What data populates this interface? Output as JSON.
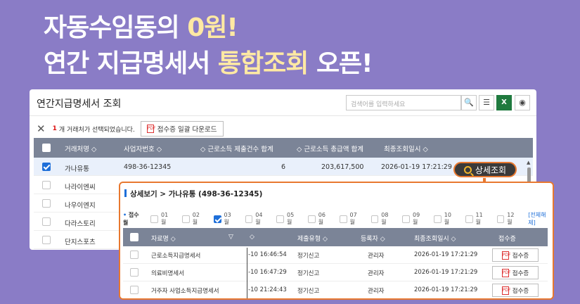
{
  "headline": {
    "line1_a": "자동수임동의 ",
    "line1_b": "0원!",
    "line2_a": "연간 지급명세서 ",
    "line2_b": "통합조회",
    "line2_c": " 오픈!"
  },
  "panel": {
    "title": "연간지급명세서 조회",
    "search_placeholder": "검색어를 입력하세요",
    "selection": {
      "count": "1",
      "text": "개 거래처가 선택되었습니다.",
      "download_label": "접수증 일괄 다운로드"
    },
    "columns": [
      "거래처명 ◇",
      "사업자번호 ◇",
      "◇ 근로소득 제출건수 합계",
      "◇ 근로소득 총급액 합계",
      "최종조회일시 ◇"
    ],
    "rows": [
      {
        "name": "가나유통",
        "bizno": "498-36-12345",
        "count": "6",
        "amount": "203,617,500",
        "date": "2026-01-19 17:21:29"
      },
      {
        "name": "나라이엔씨"
      },
      {
        "name": "나우이엔지"
      },
      {
        "name": "다라스토리"
      },
      {
        "name": "단지스포츠"
      }
    ],
    "detail_button": "상세조회"
  },
  "detail": {
    "title": "상세보기 > 가나유통 (498-36-12345)",
    "period_label": "접수월",
    "months": [
      "01월",
      "02월",
      "03월",
      "04월",
      "05월",
      "06월",
      "07월",
      "08월",
      "09월",
      "10월",
      "11월",
      "12월"
    ],
    "checked_month_index": 2,
    "reset_all": "[전체해제]",
    "columns": [
      "자료명 ◇",
      "◇",
      "제출유형 ◇",
      "등록자 ◇",
      "최종조회일시 ◇",
      "접수증"
    ],
    "rows": [
      {
        "name": "근로소득지급명세서",
        "time": "-10 16:46:54",
        "type": "정기신고",
        "user": "관리자",
        "date": "2026-01-19 17:21:29",
        "receipt": "접수증"
      },
      {
        "name": "의료비명세서",
        "time": "-10 16:47:29",
        "type": "정기신고",
        "user": "관리자",
        "date": "2026-01-19 17:21:29",
        "receipt": "접수증"
      },
      {
        "name": "거주자 사업소득지급명세서",
        "time": "-10 21:24:43",
        "type": "정기신고",
        "user": "관리자",
        "date": "2026-01-19 17:21:29",
        "receipt": "접수증"
      }
    ]
  },
  "colors": {
    "background": "#8a7cc6",
    "accent": "#e8782f",
    "highlight_text": "#ffe9a3",
    "header_bg": "#7b8497"
  }
}
